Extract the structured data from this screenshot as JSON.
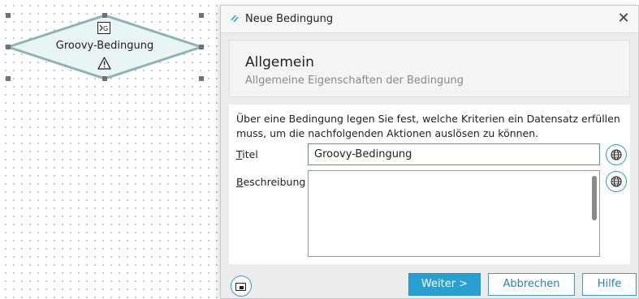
{
  "canvas": {
    "node": {
      "title": "Groovy-Bedingung",
      "type_icon": "groovy-script-icon",
      "status_icon": "warning-icon"
    }
  },
  "dialog": {
    "app_icon": "app-logo-icon",
    "title": "Neue Bedingung",
    "close_icon": "close-icon",
    "header": {
      "title": "Allgemein",
      "subtitle": "Allgemeine Eigenschaften der Bedingung"
    },
    "description": "Über eine Bedingung legen Sie fest, welche Kriterien ein Datensatz erfüllen muss, um die nachfolgenden Aktionen auslösen zu können.",
    "fields": {
      "title": {
        "label_mnemonic": "T",
        "label_rest": "itel",
        "value": "Groovy-Bedingung",
        "translate_icon": "globe-icon"
      },
      "description": {
        "label_mnemonic": "B",
        "label_rest": "eschreibung",
        "value": "",
        "translate_icon": "globe-icon"
      }
    },
    "footer": {
      "left_icon": "window-restore-icon",
      "next": "Weiter >",
      "cancel": "Abbrechen",
      "help": "Hilfe"
    }
  },
  "colors": {
    "accent": "#2aa0d2",
    "node_fill": "#e9f4f4",
    "node_stroke": "#8fb3b3",
    "handle": "#6f6f7e"
  }
}
